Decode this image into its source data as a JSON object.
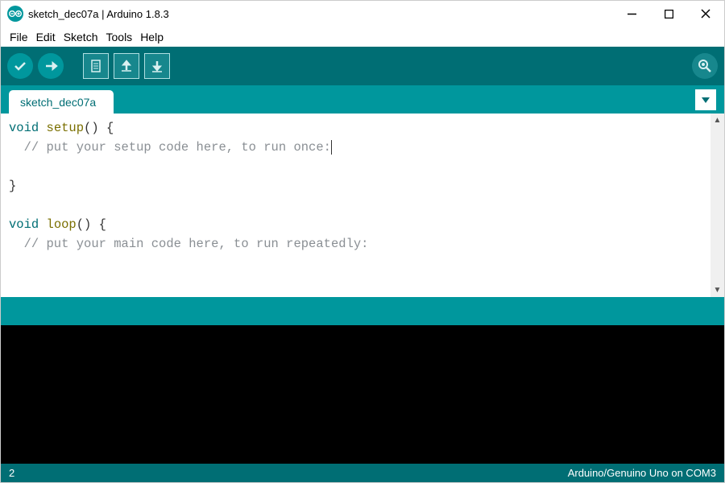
{
  "window": {
    "title": "sketch_dec07a | Arduino 1.8.3"
  },
  "menubar": {
    "items": [
      "File",
      "Edit",
      "Sketch",
      "Tools",
      "Help"
    ]
  },
  "tabs": {
    "active": "sketch_dec07a"
  },
  "code": {
    "l1_kw": "void",
    "l1_fn": "setup",
    "l1_rest": "() {",
    "l2_comment": "  // put your setup code here, to run once:",
    "l3": "",
    "l4": "}",
    "l5": "",
    "l6_kw": "void",
    "l6_fn": "loop",
    "l6_rest": "() {",
    "l7_comment": "  // put your main code here, to run repeatedly:"
  },
  "footer": {
    "line": "2",
    "board": "Arduino/Genuino Uno on COM3"
  }
}
